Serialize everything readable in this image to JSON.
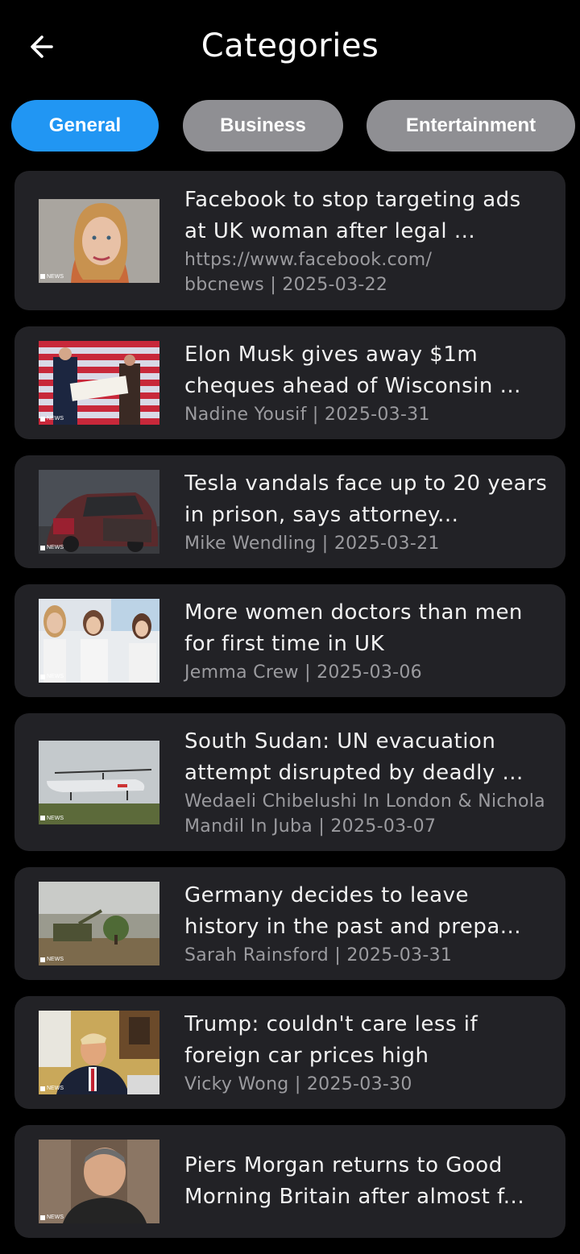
{
  "header": {
    "title": "Categories",
    "back_icon": "arrow-left-icon"
  },
  "colors": {
    "background": "#000000",
    "card": "#222226",
    "chip_active": "#2196F3",
    "chip_inactive": "#8f8f93",
    "meta_text": "#9b9b9f"
  },
  "chips": [
    {
      "label": "General",
      "active": true
    },
    {
      "label": "Business",
      "active": false
    },
    {
      "label": "Entertainment",
      "active": false
    }
  ],
  "articles": [
    {
      "title": "Facebook to stop targeting ads at UK woman after legal ...",
      "url": "https://www.facebook.com/",
      "meta": "bbcnews | 2025-03-22",
      "thumb": "portrait-woman"
    },
    {
      "title": "Elon Musk gives away $1m cheques ahead of Wisconsin ...",
      "meta": "Nadine Yousif | 2025-03-31",
      "thumb": "cheque-stage"
    },
    {
      "title": "Tesla vandals face up to 20 years in prison, says attorney...",
      "meta": "Mike Wendling | 2025-03-21",
      "thumb": "burnt-car"
    },
    {
      "title": "More women doctors than men for first time in UK",
      "meta": "Jemma Crew | 2025-03-06",
      "thumb": "doctors"
    },
    {
      "title": "South Sudan: UN evacuation attempt disrupted by deadly ...",
      "meta": "Wedaeli Chibelushi In London & Nichola Mandil In Juba | 2025-03-07",
      "thumb": "helicopter"
    },
    {
      "title": "Germany decides to leave history in the past and prepa...",
      "meta": "Sarah Rainsford | 2025-03-31",
      "thumb": "tank-field"
    },
    {
      "title": "Trump: couldn't care less if foreign car prices high",
      "meta": "Vicky Wong | 2025-03-30",
      "thumb": "oval-office"
    },
    {
      "title": "Piers Morgan returns to Good Morning Britain after almost f...",
      "meta": "",
      "thumb": "man-portrait"
    }
  ],
  "thumb_badge": "NEWS"
}
